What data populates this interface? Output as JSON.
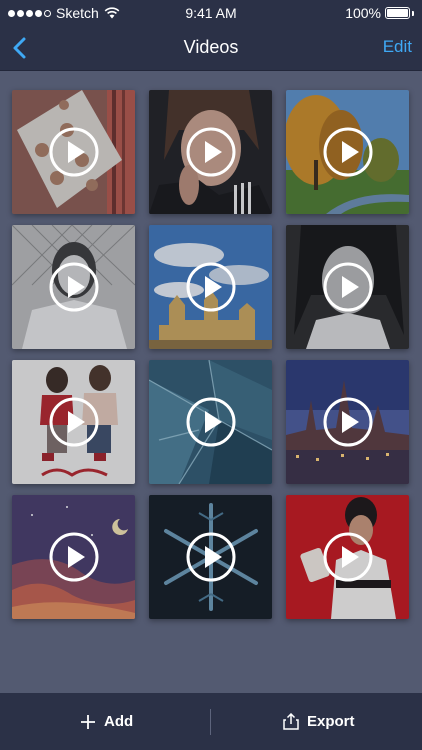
{
  "status_bar": {
    "carrier": "Sketch",
    "time": "9:41 AM",
    "battery": "100%",
    "battery_level": 1.0
  },
  "nav": {
    "title": "Videos",
    "edit_label": "Edit"
  },
  "videos": [
    {
      "icon": "play-icon"
    },
    {
      "icon": "play-icon"
    },
    {
      "icon": "play-icon"
    },
    {
      "icon": "play-icon"
    },
    {
      "icon": "play-icon"
    },
    {
      "icon": "play-icon"
    },
    {
      "icon": "play-icon"
    },
    {
      "icon": "play-icon"
    },
    {
      "icon": "play-icon"
    },
    {
      "icon": "play-icon"
    },
    {
      "icon": "play-icon"
    },
    {
      "icon": "play-icon"
    }
  ],
  "toolbar": {
    "add_label": "Add",
    "export_label": "Export"
  },
  "colors": {
    "accent": "#3fa9f5",
    "bar_bg": "#2b3147",
    "page_bg": "#535a71"
  }
}
